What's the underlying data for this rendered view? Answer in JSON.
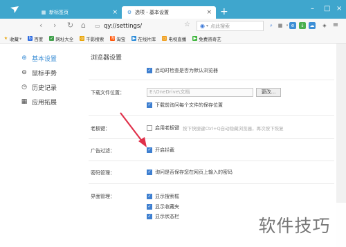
{
  "tabs": [
    {
      "label": "新标签页",
      "active": false,
      "icon": "grid-icon"
    },
    {
      "label": "选项 - 基本设置",
      "active": true,
      "icon": "gear-icon"
    }
  ],
  "toolbar": {
    "address": "qy://settings/",
    "search_placeholder": "点此搜索"
  },
  "bookmarks": [
    {
      "label": "收藏",
      "icon": "star-icon"
    },
    {
      "label": "百度",
      "icon": "baidu-icon"
    },
    {
      "label": "网址大全",
      "icon": "link-icon"
    },
    {
      "label": "千影搜索",
      "icon": "search-icon"
    },
    {
      "label": "淘宝",
      "icon": "taobao-icon"
    },
    {
      "label": "在线片库",
      "icon": "film-icon"
    },
    {
      "label": "电视直播",
      "icon": "tv-icon"
    },
    {
      "label": "免费资奇艺",
      "icon": "video-icon"
    }
  ],
  "sidebar": {
    "items": [
      {
        "label": "基本设置",
        "icon": "settings-icon",
        "active": true
      },
      {
        "label": "鼠标手势",
        "icon": "mouse-icon",
        "active": false
      },
      {
        "label": "历史记录",
        "icon": "clock-icon",
        "active": false
      },
      {
        "label": "应用拓展",
        "icon": "apps-icon",
        "active": false
      }
    ]
  },
  "main": {
    "title": "浏览器设置",
    "startup_check": {
      "label": "启动时检查是否为默认浏览器",
      "checked": true
    },
    "download": {
      "label": "下载文件位置：",
      "path": "E:\\OneDrive\\文档",
      "change_button": "更改...",
      "ask_each": {
        "label": "下载前询问每个文件的保存位置",
        "checked": true
      }
    },
    "boss_key": {
      "label": "老板键：",
      "option": {
        "label": "启用老板键",
        "checked": false
      },
      "hint": "按下快捷键Ctrl+Q自动隐藏浏览器，再次按下恢复"
    },
    "ad_filter": {
      "label": "广告过滤：",
      "option": {
        "label": "开启拦截",
        "checked": true
      }
    },
    "password": {
      "label": "密码管理：",
      "option": {
        "label": "询问是否保存您在网页上输入的密码",
        "checked": true
      }
    },
    "interface": {
      "label": "界面管理：",
      "options": [
        {
          "label": "显示搜索框",
          "checked": true
        },
        {
          "label": "显示收藏夹",
          "checked": true
        },
        {
          "label": "显示状态栏",
          "checked": true
        }
      ]
    }
  },
  "watermark": "软件技巧",
  "colors": {
    "titlebar": "#3fa6cd",
    "accent": "#3d8fd6",
    "arrow": "#e0304a"
  }
}
